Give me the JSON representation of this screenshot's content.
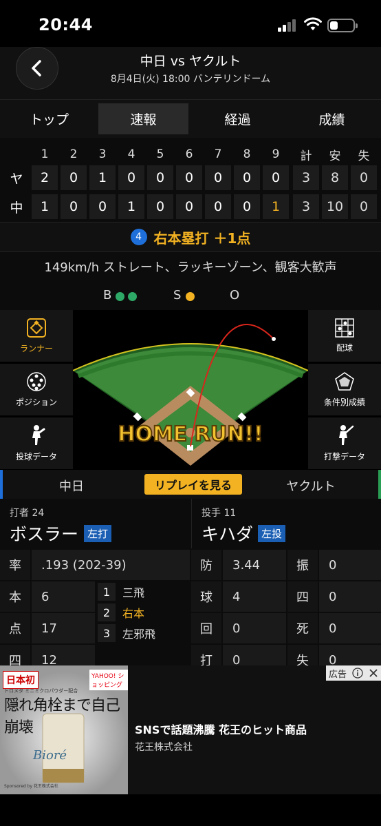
{
  "status": {
    "time": "20:44"
  },
  "header": {
    "title": "中日 vs ヤクルト",
    "subtitle": "8月4日(火) 18:00 バンテリンドーム"
  },
  "tabs": [
    {
      "label": "トップ",
      "active": false
    },
    {
      "label": "速報",
      "active": true
    },
    {
      "label": "経過",
      "active": false
    },
    {
      "label": "成績",
      "active": false
    }
  ],
  "scoreboard": {
    "headers": [
      "1",
      "2",
      "3",
      "4",
      "5",
      "6",
      "7",
      "8",
      "9",
      "計",
      "安",
      "失"
    ],
    "rows": [
      {
        "team": "ヤ",
        "cells": [
          "2",
          "0",
          "1",
          "0",
          "0",
          "0",
          "0",
          "0",
          "0",
          "3",
          "8",
          "0"
        ]
      },
      {
        "team": "中",
        "cells": [
          "1",
          "0",
          "0",
          "1",
          "0",
          "0",
          "0",
          "0",
          "1",
          "3",
          "10",
          "0"
        ]
      }
    ]
  },
  "event": {
    "number": "4",
    "text": "右本塁打 ＋1点"
  },
  "detail": "149km/h ストレート、ラッキーゾーン、観客大歓声",
  "count": {
    "ball_label": "B",
    "balls": 2,
    "strike_label": "S",
    "strikes": 1,
    "out_label": "O",
    "outs": 0
  },
  "colors": {
    "ball": "#2ea866",
    "strike": "#f2b222",
    "accent": "#f2b222",
    "home_team": "#1e6fd9",
    "away_team": "#2a9d55"
  },
  "side_left": [
    {
      "label": "ランナー",
      "icon": "runner-diamond-icon",
      "active": true
    },
    {
      "label": "ポジション",
      "icon": "position-dots-icon",
      "active": false
    },
    {
      "label": "投球データ",
      "icon": "pitcher-icon",
      "active": false
    }
  ],
  "side_right": [
    {
      "label": "配球",
      "icon": "pitch-grid-icon",
      "active": false
    },
    {
      "label": "条件別成績",
      "icon": "radar-chart-icon",
      "active": false
    },
    {
      "label": "打撃データ",
      "icon": "batter-icon",
      "active": false
    }
  ],
  "field": {
    "banner": "HOME RUN!!"
  },
  "team_tabs": {
    "left": "中日",
    "replay": "リプレイを見る",
    "right": "ヤクルト"
  },
  "batter": {
    "role": "打者 24",
    "name": "ボスラー",
    "hand": "左打"
  },
  "pitcher": {
    "role": "投手 11",
    "name": "キハダ",
    "hand": "左投"
  },
  "batter_stats": [
    {
      "key": "率",
      "value": ".193 (202-39)"
    },
    {
      "key": "本",
      "value": "6"
    },
    {
      "key": "点",
      "value": "17"
    },
    {
      "key": "四",
      "value": "12"
    }
  ],
  "at_bats": [
    {
      "n": "1",
      "result": "三飛",
      "current": false
    },
    {
      "n": "2",
      "result": "右本",
      "current": true
    },
    {
      "n": "3",
      "result": "左邪飛",
      "current": false
    }
  ],
  "pitcher_stats": [
    {
      "k1": "防",
      "v1": "3.44",
      "k2": "振",
      "v2": "0"
    },
    {
      "k1": "球",
      "v1": "4",
      "k2": "四",
      "v2": "0"
    },
    {
      "k1": "回",
      "v1": "0",
      "k2": "死",
      "v2": "0"
    },
    {
      "k1": "打",
      "v1": "0",
      "k2": "失",
      "v2": "0"
    }
  ],
  "ad": {
    "badge": "日本初",
    "yahoo": "YAHOO! ショッピング",
    "small": "トロメタ ミニミクロパウダー配合",
    "headline": "隠れ角栓まで自己崩壊",
    "brand": "Bioré",
    "sponsor": "Sponsored by 花王株式会社",
    "title": "SNSで話題沸騰 花王のヒット商品",
    "company": "花王株式会社",
    "tag": "広告"
  }
}
